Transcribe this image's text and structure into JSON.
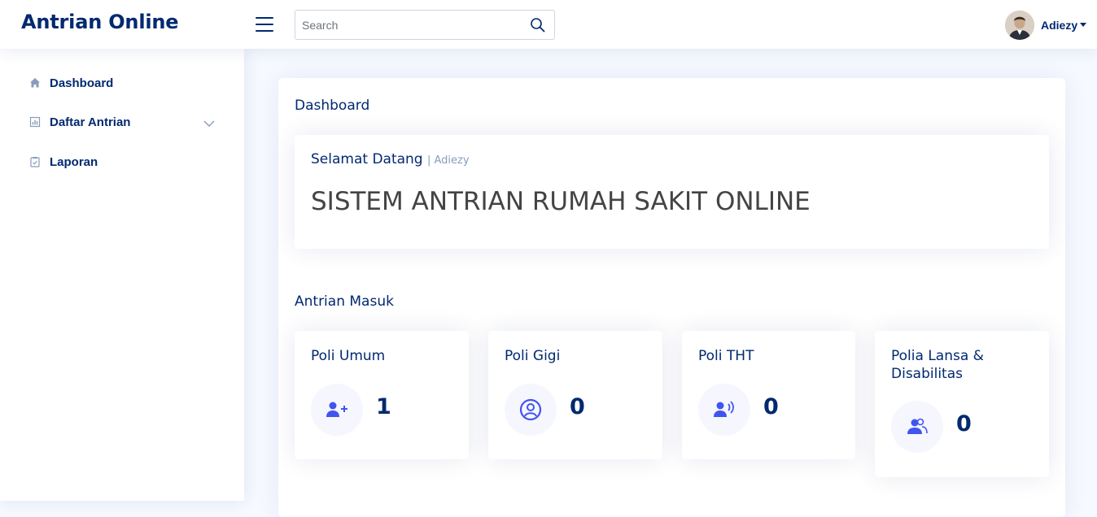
{
  "header": {
    "logo": "Antrian Online",
    "search_placeholder": "Search",
    "user_name": "Adiezy"
  },
  "sidebar": {
    "items": [
      {
        "label": "Dashboard",
        "icon": "house-icon"
      },
      {
        "label": "Daftar Antrian",
        "icon": "bar-chart-icon"
      },
      {
        "label": "Laporan",
        "icon": "clipboard-check-icon"
      }
    ]
  },
  "main": {
    "title": "Dashboard",
    "welcome": {
      "title": "Selamat Datang",
      "sub": "| Adiezy",
      "headline": "SISTEM ANTRIAN RUMAH SAKIT ONLINE"
    },
    "section_title": "Antrian Masuk",
    "stats": [
      {
        "title": "Poli Umum",
        "value": "1",
        "icon": "person-plus-icon"
      },
      {
        "title": "Poli Gigi",
        "value": "0",
        "icon": "person-circle-icon"
      },
      {
        "title": "Poli THT",
        "value": "0",
        "icon": "person-voice-icon"
      },
      {
        "title": "Polia Lansa & Disabilitas",
        "value": "0",
        "icon": "people-icon"
      }
    ]
  },
  "colors": {
    "primary": "#012970",
    "accent": "#4154f1",
    "background": "#f6f9ff"
  }
}
